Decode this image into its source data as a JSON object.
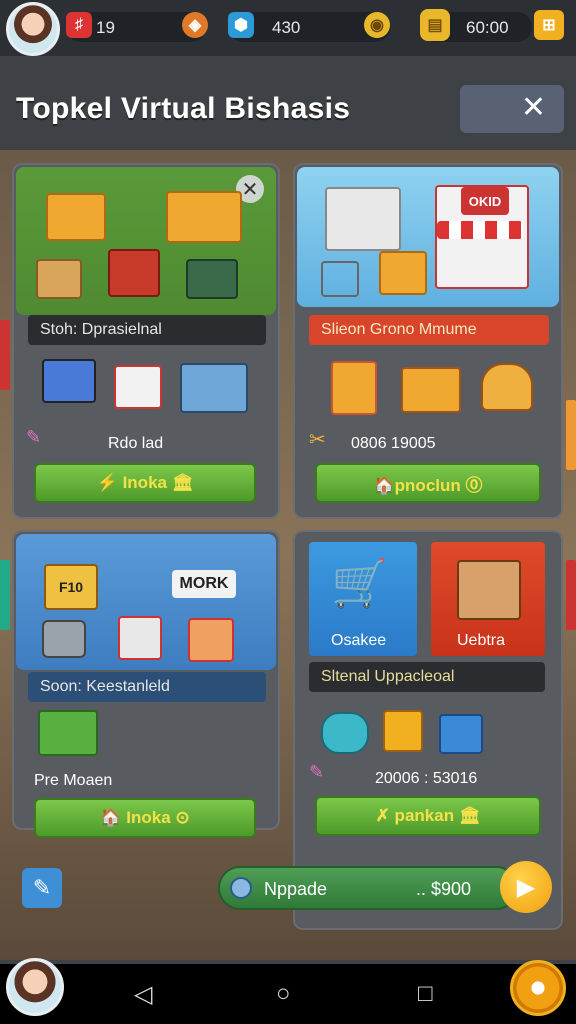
{
  "topbar": {
    "stat1": "19",
    "stat2": "430",
    "stat3": "60:00"
  },
  "header": {
    "title": "Topkel Virtual Bishasis",
    "close_symbol": "✕"
  },
  "cards": [
    {
      "label": "Stoh: Dprasielnal",
      "stat": "Rdo lad",
      "button": "⚡ Inoka 🏛"
    },
    {
      "label": "Slieon Grono Mmume",
      "stat": "0806 19005",
      "button": "🏠pnoclun 🄋"
    },
    {
      "label": "Soon: Keestanleld",
      "stat": "Pre Moaen",
      "button": "🏠 Inoka ⊙"
    },
    {
      "label": "Sltenal Uppacleoal",
      "tile1": "Osakee",
      "tile2": "Uebtra",
      "stat": "20006 : 53016",
      "button": "✗ pankan 🏛"
    }
  ],
  "signs": {
    "sign1": "F10",
    "sign2": "MORK",
    "sign3": "OKID"
  },
  "upgrade": {
    "label": "Nppade",
    "price": ".. $900"
  },
  "icons": {
    "close": "close-icon",
    "play": "play-icon",
    "pencil": "pencil-icon"
  }
}
